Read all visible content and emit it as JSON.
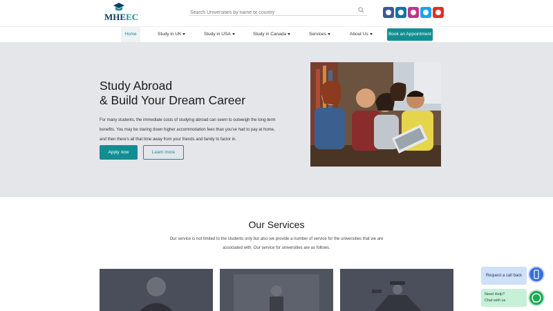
{
  "header": {
    "logo": {
      "part1": "MHE",
      "part2": "EC"
    },
    "search": {
      "placeholder": "Search Universities by name or country"
    },
    "socials": [
      {
        "name": "facebook-icon",
        "color": "#3b5998"
      },
      {
        "name": "linkedin-icon",
        "color": "#0e76a8"
      },
      {
        "name": "instagram-icon",
        "color": "#c13584"
      },
      {
        "name": "twitter-icon",
        "color": "#1da1f2"
      },
      {
        "name": "youtube-icon",
        "color": "#e52d27"
      }
    ]
  },
  "nav": {
    "items": [
      {
        "label": "Home",
        "active": true
      },
      {
        "label": "Study in UK",
        "dropdown": true
      },
      {
        "label": "Study in USA",
        "dropdown": true
      },
      {
        "label": "Study in Canada",
        "dropdown": true
      },
      {
        "label": "Services",
        "dropdown": true
      },
      {
        "label": "About Us",
        "dropdown": true
      }
    ],
    "cta": "Book an Appointment"
  },
  "hero": {
    "title_line1": "Study Abroad",
    "title_line2": "& Build Your Dream Career",
    "text": "For many students, the immediate costs of studying abroad can seem to outweigh the long-term benefits. You may be staring down higher accommodation fees than you've had to pay at home, and then there's all that time away from your friends and family to factor in.",
    "apply_label": "Apply now",
    "learn_label": "Learn more"
  },
  "services": {
    "title": "Our Services",
    "text": "Our service is not limited to the students only but also we provide a number of service for the universities that we are associated with. Our service for universities are as follows."
  },
  "widgets": {
    "callback_label": "Request a call back",
    "chat_line1": "Need Help?",
    "chat_line2": "Chat with us"
  },
  "colors": {
    "accent": "#128e92",
    "hero_bg": "#e4e6ea"
  }
}
